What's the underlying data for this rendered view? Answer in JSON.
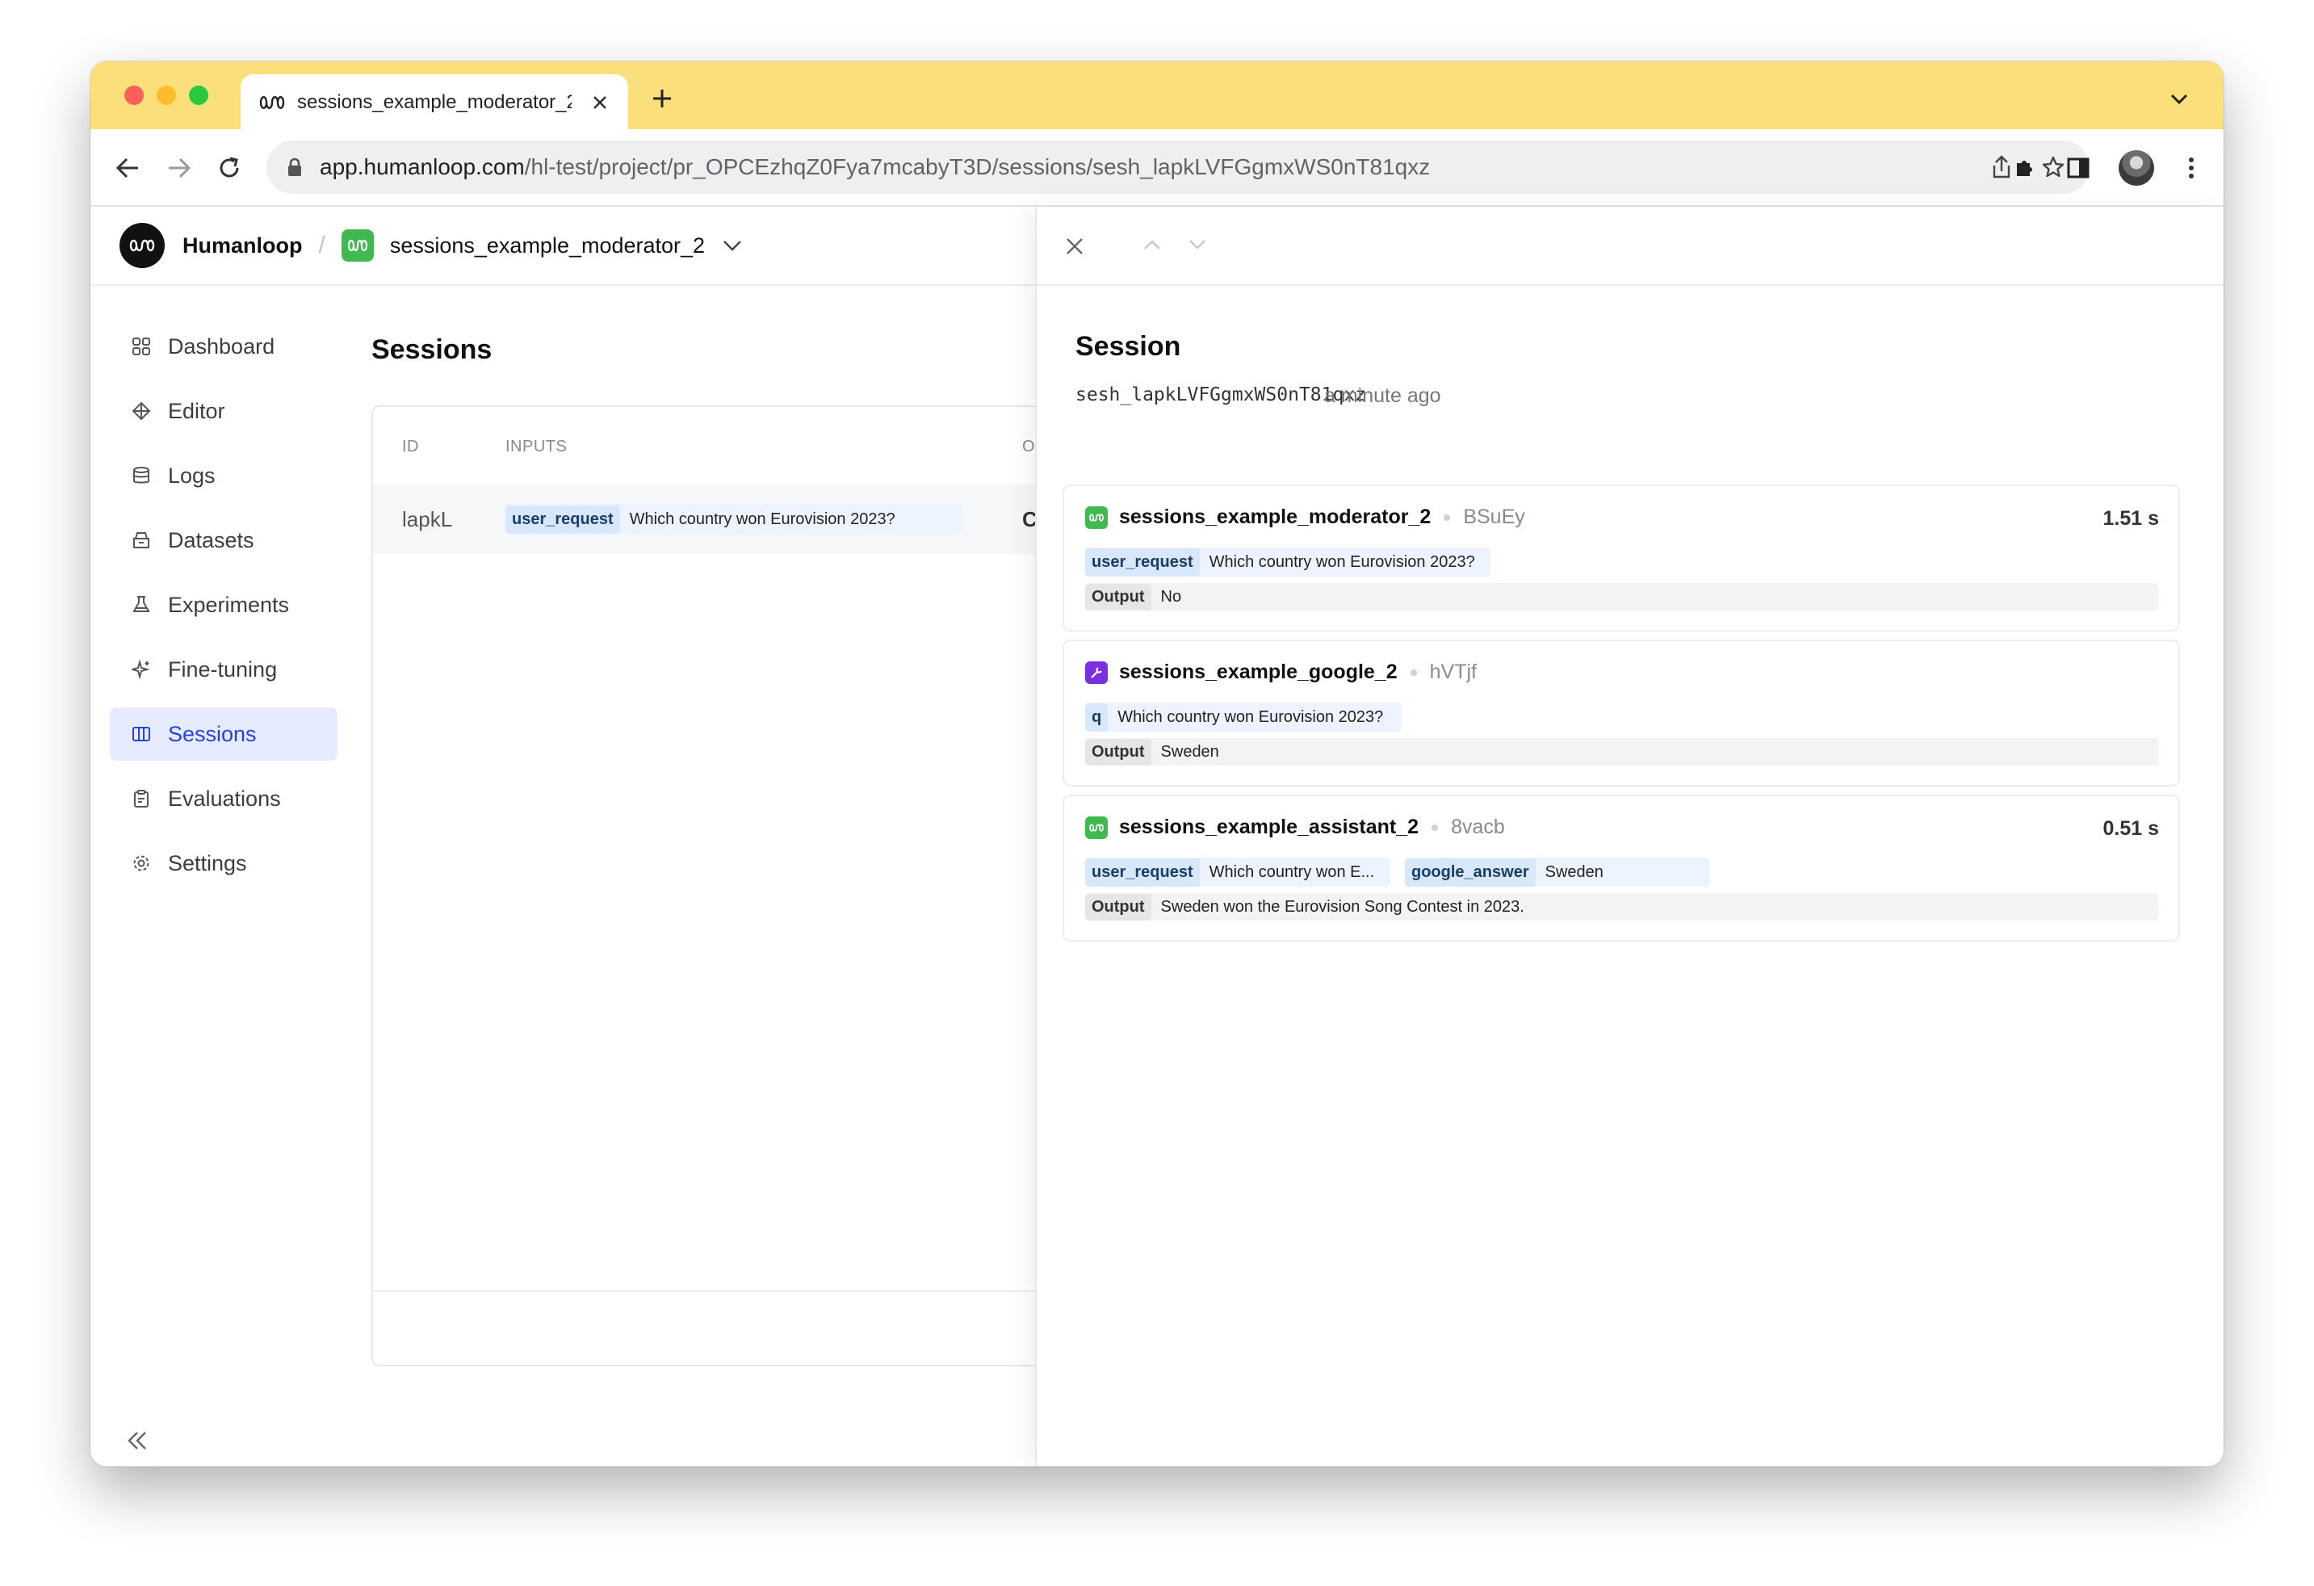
{
  "browser": {
    "tab_title": "sessions_example_moderator_2",
    "url_host": "app.humanloop.com",
    "url_path": "/hl-test/project/pr_OPCEzhqZ0Fya7mcabyT3D/sessions/sesh_lapkLVFGgmxWS0nT81qxz"
  },
  "header": {
    "brand": "Humanloop",
    "separator": "/",
    "project_name": "sessions_example_moderator_2"
  },
  "sidebar": {
    "items": [
      {
        "label": "Dashboard",
        "icon": "grid-icon"
      },
      {
        "label": "Editor",
        "icon": "diamond-icon"
      },
      {
        "label": "Logs",
        "icon": "database-icon"
      },
      {
        "label": "Datasets",
        "icon": "archive-icon"
      },
      {
        "label": "Experiments",
        "icon": "flask-icon"
      },
      {
        "label": "Fine-tuning",
        "icon": "sparkle-icon"
      },
      {
        "label": "Sessions",
        "icon": "columns-icon",
        "active": true
      },
      {
        "label": "Evaluations",
        "icon": "clipboard-icon"
      },
      {
        "label": "Settings",
        "icon": "gear-icon"
      }
    ]
  },
  "main": {
    "title": "Sessions",
    "columns": [
      "ID",
      "INPUTS",
      "O"
    ],
    "rows": [
      {
        "id": "lapkL",
        "input_key": "user_request",
        "input_value": "Which country won Eurovision 2023?",
        "output_cut": "C"
      }
    ]
  },
  "session": {
    "title": "Session",
    "id": "sesh_lapkLVFGgmxWS0nT81qxz",
    "time": "a minute ago",
    "output_label": "Output",
    "logs": [
      {
        "name": "sessions_example_moderator_2",
        "short_id": "BSuEy",
        "duration": "1.51 s",
        "icon_color": "#3fb950",
        "inputs": [
          {
            "key": "user_request",
            "value": "Which country won Eurovision 2023?"
          }
        ],
        "output": "No"
      },
      {
        "name": "sessions_example_google_2",
        "short_id": "hVTjf",
        "duration": "",
        "icon_color": "#7b2fe0",
        "inputs": [
          {
            "key": "q",
            "value": "Which country won Eurovision 2023?"
          }
        ],
        "output": "Sweden"
      },
      {
        "name": "sessions_example_assistant_2",
        "short_id": "8vacb",
        "duration": "0.51 s",
        "icon_color": "#3fb950",
        "inputs": [
          {
            "key": "user_request",
            "value": "Which country won E..."
          },
          {
            "key": "google_answer",
            "value": "Sweden"
          }
        ],
        "output": "Sweden won the Eurovision Song Contest in 2023."
      }
    ]
  },
  "colors": {
    "tabstrip": "#fbdf7b",
    "accent": "#2343e8",
    "active_nav_bg": "#e6ebff"
  }
}
